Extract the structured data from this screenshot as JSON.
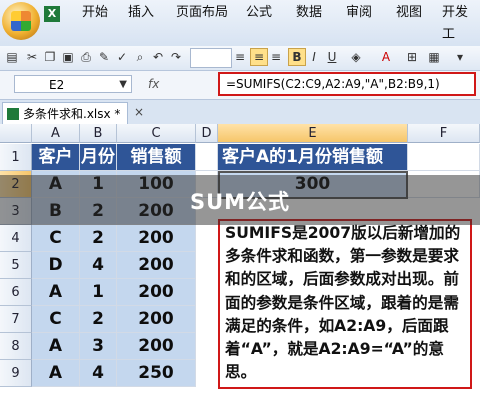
{
  "ribbon": {
    "tabs": [
      "开始",
      "插入",
      "页面布局",
      "公式",
      "数据",
      "审阅",
      "视图",
      "开发工"
    ],
    "active_tab": "开始"
  },
  "formula_bar": {
    "name_box": "E2",
    "fx_label": "fx",
    "formula": "=SUMIFS(C2:C9,A2:A9,\"A\",B2:B9,1)"
  },
  "document": {
    "tab_name": "多条件求和.xlsx *",
    "close_glyph": "×"
  },
  "sheet": {
    "columns": [
      "A",
      "B",
      "C",
      "D",
      "E",
      "F"
    ],
    "rows": [
      "1",
      "2",
      "3",
      "4",
      "5",
      "6",
      "7",
      "8",
      "9"
    ],
    "headers": [
      "客户",
      "月份",
      "销售额"
    ],
    "data": [
      [
        "A",
        "1",
        "100"
      ],
      [
        "B",
        "2",
        "200"
      ],
      [
        "C",
        "2",
        "200"
      ],
      [
        "D",
        "4",
        "200"
      ],
      [
        "A",
        "1",
        "200"
      ],
      [
        "C",
        "2",
        "200"
      ],
      [
        "A",
        "3",
        "200"
      ],
      [
        "A",
        "4",
        "250"
      ]
    ],
    "e1": "客户A的1月份销售额",
    "e2": "300",
    "selected_cell": "E2"
  },
  "note": "SUMIFS是2007版以后新增加的多条件求和函数，第一参数是要求和的区域，后面参数成对出现。前面的参数是条件区域，跟着的是需满足的条件，如A2:A9，后面跟着“A”，就是A2:A9=“A”的意思。",
  "overlay": {
    "title": "SUM公式"
  },
  "colors": {
    "header_fill": "#2f5597",
    "highlight_fill": "#c4d7ee",
    "callout_border": "#d01818"
  }
}
